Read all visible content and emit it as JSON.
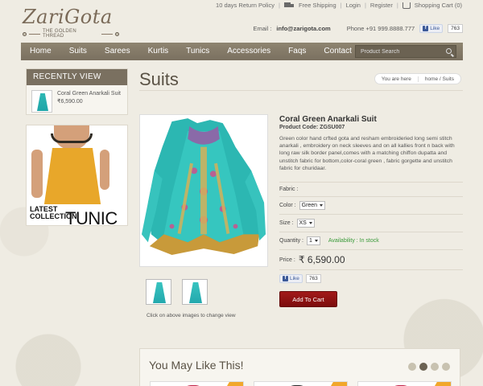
{
  "brand": {
    "name": "ZariGota",
    "tagline": "THE GOLDEN THREAD"
  },
  "toplinks": {
    "returns": "10 days Return Policy",
    "shipping": "Free Shipping",
    "login": "Login",
    "register": "Register",
    "cart": "Shopping Cart (0)"
  },
  "contact": {
    "email_label": "Email :",
    "email": "info@zarigota.com",
    "phone": "Phone +91 999.8888.777",
    "fb_like": "Like",
    "fb_count": "763"
  },
  "nav": {
    "items": [
      "Home",
      "Suits",
      "Sarees",
      "Kurtis",
      "Tunics",
      "Accessories",
      "Faqs",
      "Contact"
    ],
    "search_placeholder": "Product Search"
  },
  "sidebar": {
    "recent_title": "RECENTLY VIEW",
    "recent_item_name": "Coral Green Anarkali Suit",
    "recent_item_price": "₹6,590.00",
    "promo_line1": "LATEST",
    "promo_line2": "COLLECTION",
    "promo_big": "TUNIC"
  },
  "page": {
    "title": "Suits",
    "breadcrumb_you": "You are here",
    "breadcrumb_path": "home  /  Suits"
  },
  "product": {
    "name": "Coral Green Anarkali Suit",
    "code": "Product Code: ZGSU007",
    "description": "Green color hand crfted gota and resham embroideried long semi stitch anarkali , embroidery on neck sleeves and on all kallies front n back with long raw silk  border panel,comes with a matching chiffon dupatta and unstitch fabric for bottom,color-coral green , fabric gorgette  and unstitch fabric for churidaar.",
    "fabric_label": "Fabric :",
    "color_label": "Color :",
    "color_value": "Green",
    "size_label": "Size :",
    "size_value": "XS",
    "quantity_label": "Quantity :",
    "quantity_value": "1",
    "availability": "Availability : In stock",
    "price_label": "Price :",
    "price_value": "₹ 6,590.00",
    "fb_like": "Like",
    "fb_count": "763",
    "add_to_cart": "Add To Cart",
    "thumbs_caption": "Click on above images to change view"
  },
  "maylike": {
    "title": "You May Like This!"
  },
  "colors": {
    "nav_bg": "#7f7563",
    "accent_red": "#8c1212",
    "dress_teal": "#2fb8b4",
    "stock_green": "#3a9a3a"
  }
}
